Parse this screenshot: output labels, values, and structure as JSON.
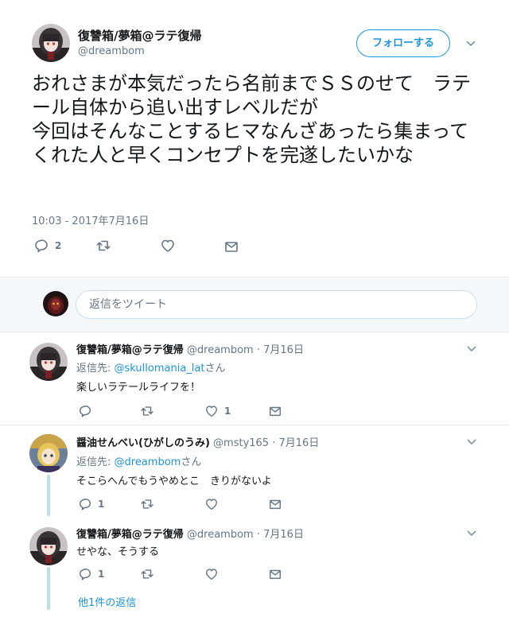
{
  "main_tweet": {
    "author_name": "復讐箱/夢箱@ラテ復帰",
    "author_handle": "@dreambom",
    "follow_label": "フォローする",
    "text": "おれさまが本気だったら名前までＳＳのせて　ラテール自体から追い出すレベルだが\n今回はそんなことするヒマなんざあったら集まってくれた人と早くコンセプトを完遂したいかな",
    "timestamp": "10:03 - 2017年7月16日",
    "reply_count": "2",
    "retweet_count": "",
    "like_count": ""
  },
  "reply_box": {
    "placeholder": "返信をツイート"
  },
  "replies": [
    {
      "author_name": "復讐箱/夢箱@ラテ復帰",
      "author_handle": "@dreambom",
      "date": "7月16日",
      "reply_to_prefix": "返信先: ",
      "reply_to_mention": "@skullomania_lat",
      "reply_to_suffix": "さん",
      "text": "楽しいラテールライフを！",
      "reply_count": "",
      "retweet_count": "",
      "like_count": "1"
    },
    {
      "author_name": "醤油せんべい(ひがしのうみ)",
      "author_handle": "@msty165",
      "date": "7月16日",
      "reply_to_prefix": "返信先: ",
      "reply_to_mention": "@dreambom",
      "reply_to_suffix": "さん",
      "text": "そこらへんでもうやめとこ　きりがないよ",
      "reply_count": "1",
      "retweet_count": "",
      "like_count": ""
    },
    {
      "author_name": "復讐箱/夢箱@ラテ復帰",
      "author_handle": "@dreambom",
      "date": "7月16日",
      "text": "せやな、そうする",
      "reply_count": "1",
      "retweet_count": "",
      "like_count": ""
    }
  ],
  "more_replies_label": "他1件の返信",
  "separator": "·",
  "icons": {
    "reply": "reply-icon",
    "retweet": "retweet-icon",
    "like": "heart-icon",
    "dm": "envelope-icon",
    "caret": "chevron-down-icon"
  },
  "colors": {
    "accent": "#1b95e0",
    "text": "#14171a",
    "secondary": "#657786",
    "thread_line": "#b8e0e5"
  }
}
